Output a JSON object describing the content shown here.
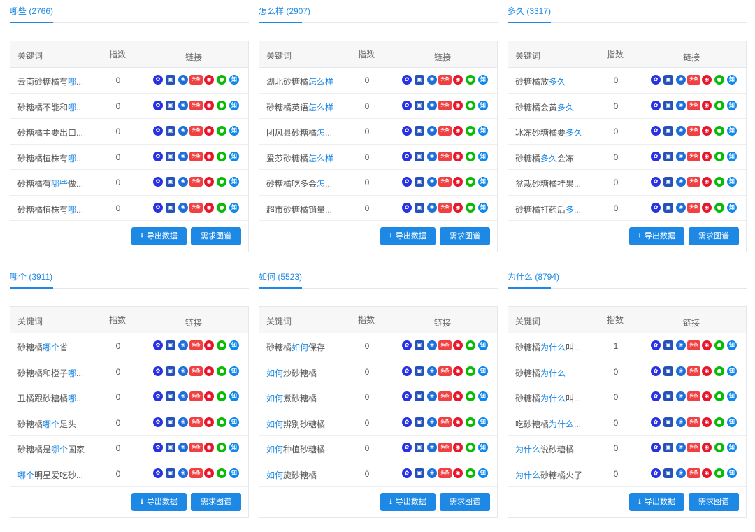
{
  "panels": [
    {
      "tab": "哪些 (2766)",
      "headers": {
        "keyword": "关键词",
        "index": "指数",
        "links": "链接"
      },
      "rows": [
        {
          "pre": "云南砂糖橘有",
          "hl": "哪",
          "post": "...",
          "index": "0"
        },
        {
          "pre": "砂糖橘不能和",
          "hl": "哪",
          "post": "...",
          "index": "0"
        },
        {
          "pre": "砂糖橘主要出口...",
          "hl": "",
          "post": "",
          "index": "0"
        },
        {
          "pre": "砂糖橘植株有",
          "hl": "哪",
          "post": "...",
          "index": "0"
        },
        {
          "pre": "砂糖橘有",
          "hl": "哪些",
          "post": "做...",
          "index": "0"
        },
        {
          "pre": "砂糖橘植株有",
          "hl": "哪",
          "post": "...",
          "index": "0"
        }
      ],
      "export_label": "导出数据",
      "graph_label": "需求图谱"
    },
    {
      "tab": "怎么样 (2907)",
      "headers": {
        "keyword": "关键词",
        "index": "指数",
        "links": "链接"
      },
      "rows": [
        {
          "pre": "湖北砂糖橘",
          "hl": "怎么样",
          "post": "",
          "index": "0"
        },
        {
          "pre": "砂糖橘英语",
          "hl": "怎么样",
          "post": "",
          "index": "0"
        },
        {
          "pre": "团风县砂糖橘",
          "hl": "怎",
          "post": "...",
          "index": "0"
        },
        {
          "pre": "爱莎砂糖橘",
          "hl": "怎么样",
          "post": "",
          "index": "0"
        },
        {
          "pre": "砂糖橘吃多会",
          "hl": "怎",
          "post": "...",
          "index": "0"
        },
        {
          "pre": "超市砂糖橘销量...",
          "hl": "",
          "post": "",
          "index": "0"
        }
      ],
      "export_label": "导出数据",
      "graph_label": "需求图谱"
    },
    {
      "tab": "多久 (3317)",
      "headers": {
        "keyword": "关键词",
        "index": "指数",
        "links": "链接"
      },
      "rows": [
        {
          "pre": "砂糖橘放",
          "hl": "多久",
          "post": "",
          "index": "0"
        },
        {
          "pre": "砂糖橘会黄",
          "hl": "多久",
          "post": "",
          "index": "0"
        },
        {
          "pre": "冰冻砂糖橘要",
          "hl": "多久",
          "post": "",
          "index": "0"
        },
        {
          "pre": "砂糖橘",
          "hl": "多久",
          "post": "会冻",
          "index": "0"
        },
        {
          "pre": "盆栽砂糖橘挂果...",
          "hl": "",
          "post": "",
          "index": "0"
        },
        {
          "pre": "砂糖橘打药后",
          "hl": "多",
          "post": "...",
          "index": "0"
        }
      ],
      "export_label": "导出数据",
      "graph_label": "需求图谱"
    },
    {
      "tab": "哪个 (3911)",
      "headers": {
        "keyword": "关键词",
        "index": "指数",
        "links": "链接"
      },
      "rows": [
        {
          "pre": "砂糖橘",
          "hl": "哪个",
          "post": "省",
          "index": "0"
        },
        {
          "pre": "砂糖橘和橙子",
          "hl": "哪",
          "post": "...",
          "index": "0"
        },
        {
          "pre": "丑橘跟砂糖橘",
          "hl": "哪",
          "post": "...",
          "index": "0"
        },
        {
          "pre": "砂糖橘",
          "hl": "哪个",
          "post": "是头",
          "index": "0"
        },
        {
          "pre": "砂糖橘是",
          "hl": "哪个",
          "post": "国家",
          "index": "0"
        },
        {
          "pre": "",
          "hl": "哪个",
          "post": "明星爱吃砂...",
          "index": "0"
        }
      ],
      "export_label": "导出数据",
      "graph_label": "需求图谱"
    },
    {
      "tab": "如何 (5523)",
      "headers": {
        "keyword": "关键词",
        "index": "指数",
        "links": "链接"
      },
      "rows": [
        {
          "pre": "砂糖橘",
          "hl": "如何",
          "post": "保存",
          "index": "0"
        },
        {
          "pre": "",
          "hl": "如何",
          "post": "炒砂糖橘",
          "index": "0"
        },
        {
          "pre": "",
          "hl": "如何",
          "post": "煮砂糖橘",
          "index": "0"
        },
        {
          "pre": "",
          "hl": "如何",
          "post": "辨别砂糖橘",
          "index": "0"
        },
        {
          "pre": "",
          "hl": "如何",
          "post": "种植砂糖橘",
          "index": "0"
        },
        {
          "pre": "",
          "hl": "如何",
          "post": "旋砂糖橘",
          "index": "0"
        }
      ],
      "export_label": "导出数据",
      "graph_label": "需求图谱"
    },
    {
      "tab": "为什么 (8794)",
      "headers": {
        "keyword": "关键词",
        "index": "指数",
        "links": "链接"
      },
      "rows": [
        {
          "pre": "砂糖橘",
          "hl": "为什么",
          "post": "叫...",
          "index": "1"
        },
        {
          "pre": "砂糖橘",
          "hl": "为什么",
          "post": "",
          "index": "0"
        },
        {
          "pre": "砂糖橘",
          "hl": "为什么",
          "post": "叫...",
          "index": "0"
        },
        {
          "pre": "吃砂糖橘",
          "hl": "为什么",
          "post": "...",
          "index": "0"
        },
        {
          "pre": "",
          "hl": "为什么",
          "post": "说砂糖橘",
          "index": "0"
        },
        {
          "pre": "",
          "hl": "为什么",
          "post": "砂糖橘火了",
          "index": "0"
        }
      ],
      "export_label": "导出数据",
      "graph_label": "需求图谱"
    }
  ],
  "link_icons": [
    {
      "name": "baidu-icon",
      "glyph": "✿",
      "color": "#2932e1"
    },
    {
      "name": "sogou-icon",
      "glyph": "▣",
      "color": "#2452b8"
    },
    {
      "name": "so360-icon",
      "glyph": "❀",
      "color": "#1e6fd9"
    },
    {
      "name": "toutiao-icon",
      "glyph": "头条",
      "color": "#f04142"
    },
    {
      "name": "weibo-icon",
      "glyph": "◉",
      "color": "#e6162d"
    },
    {
      "name": "wechat-icon",
      "glyph": "●",
      "color": "#09bb07"
    },
    {
      "name": "zhihu-icon",
      "glyph": "知",
      "color": "#0f88eb"
    }
  ],
  "accent_color": "#1e88e5"
}
